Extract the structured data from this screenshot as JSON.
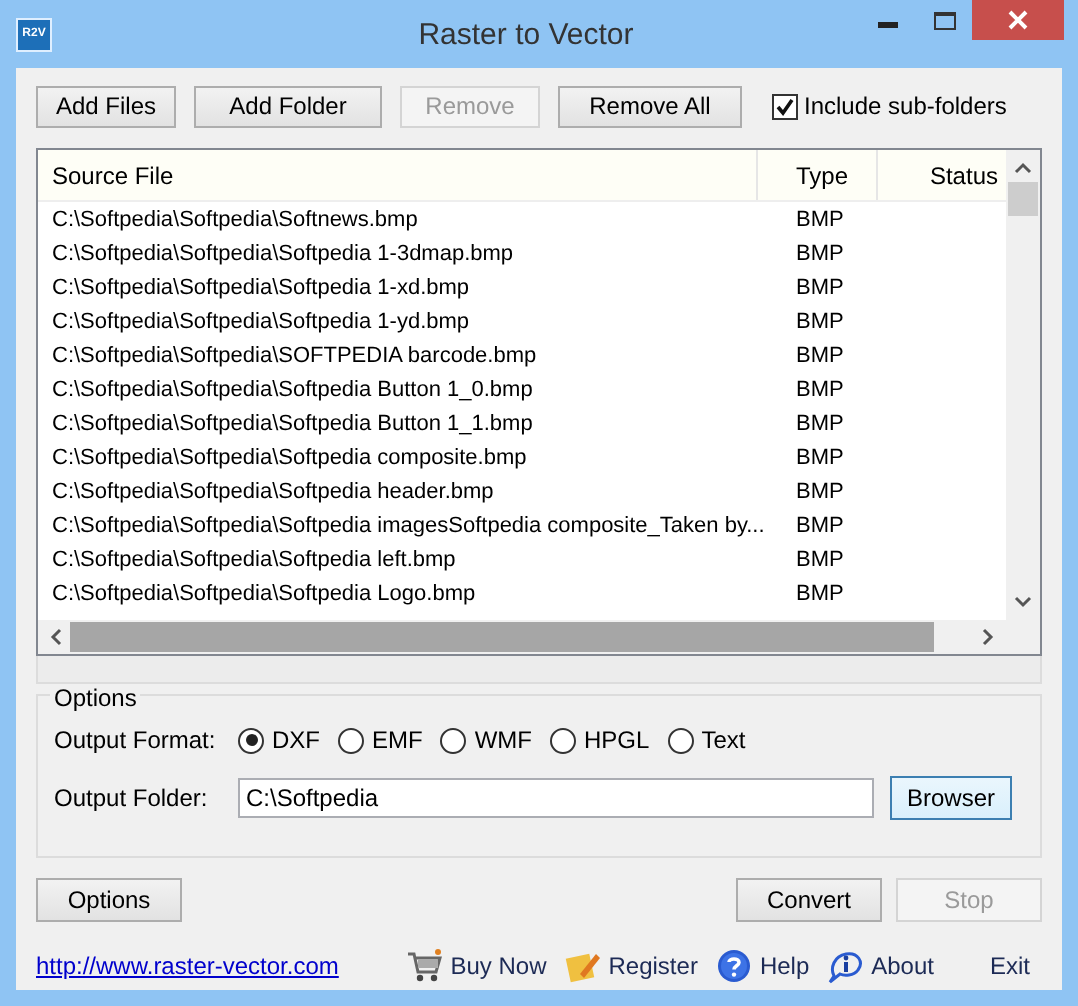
{
  "window": {
    "title": "Raster to Vector",
    "app_icon": "R2V"
  },
  "toolbar": {
    "buttons": [
      {
        "label": "Add Files",
        "disabled": false
      },
      {
        "label": "Add Folder",
        "disabled": false
      },
      {
        "label": "Remove",
        "disabled": true
      },
      {
        "label": "Remove All",
        "disabled": false
      }
    ],
    "include_subfolders": {
      "label": "Include sub-folders",
      "checked": true
    }
  },
  "table": {
    "columns": [
      "Source File",
      "Type",
      "Status"
    ],
    "rows": [
      {
        "source": "C:\\Softpedia\\Softpedia\\Softnews.bmp",
        "type": "BMP"
      },
      {
        "source": "C:\\Softpedia\\Softpedia\\Softpedia 1-3dmap.bmp",
        "type": "BMP"
      },
      {
        "source": "C:\\Softpedia\\Softpedia\\Softpedia 1-xd.bmp",
        "type": "BMP"
      },
      {
        "source": "C:\\Softpedia\\Softpedia\\Softpedia 1-yd.bmp",
        "type": "BMP"
      },
      {
        "source": "C:\\Softpedia\\Softpedia\\SOFTPEDIA barcode.bmp",
        "type": "BMP"
      },
      {
        "source": "C:\\Softpedia\\Softpedia\\Softpedia Button 1_0.bmp",
        "type": "BMP"
      },
      {
        "source": "C:\\Softpedia\\Softpedia\\Softpedia Button 1_1.bmp",
        "type": "BMP"
      },
      {
        "source": "C:\\Softpedia\\Softpedia\\Softpedia composite.bmp",
        "type": "BMP"
      },
      {
        "source": "C:\\Softpedia\\Softpedia\\Softpedia header.bmp",
        "type": "BMP"
      },
      {
        "source": "C:\\Softpedia\\Softpedia\\Softpedia imagesSoftpedia composite_Taken by...",
        "type": "BMP"
      },
      {
        "source": "C:\\Softpedia\\Softpedia\\Softpedia left.bmp",
        "type": "BMP"
      },
      {
        "source": "C:\\Softpedia\\Softpedia\\Softpedia Logo.bmp",
        "type": "BMP"
      }
    ]
  },
  "options": {
    "title": "Options",
    "format_label": "Output Format:",
    "formats": [
      {
        "label": "DXF",
        "selected": true
      },
      {
        "label": "EMF",
        "selected": false
      },
      {
        "label": "WMF",
        "selected": false
      },
      {
        "label": "HPGL",
        "selected": false
      },
      {
        "label": "Text",
        "selected": false
      }
    ],
    "folder_label": "Output Folder:",
    "folder_value": "C:\\Softpedia",
    "browse_button": "Browser"
  },
  "actions": [
    {
      "label": "Options",
      "disabled": false
    },
    {
      "label": "Convert",
      "disabled": false
    },
    {
      "label": "Stop",
      "disabled": true
    }
  ],
  "footer": {
    "link": "http://www.raster-vector.com",
    "items": [
      {
        "kind": "cart",
        "label": "Buy Now"
      },
      {
        "kind": "register",
        "label": "Register"
      },
      {
        "kind": "help",
        "label": "Help"
      },
      {
        "kind": "about",
        "label": "About"
      },
      {
        "kind": "none",
        "label": "Exit"
      }
    ]
  }
}
